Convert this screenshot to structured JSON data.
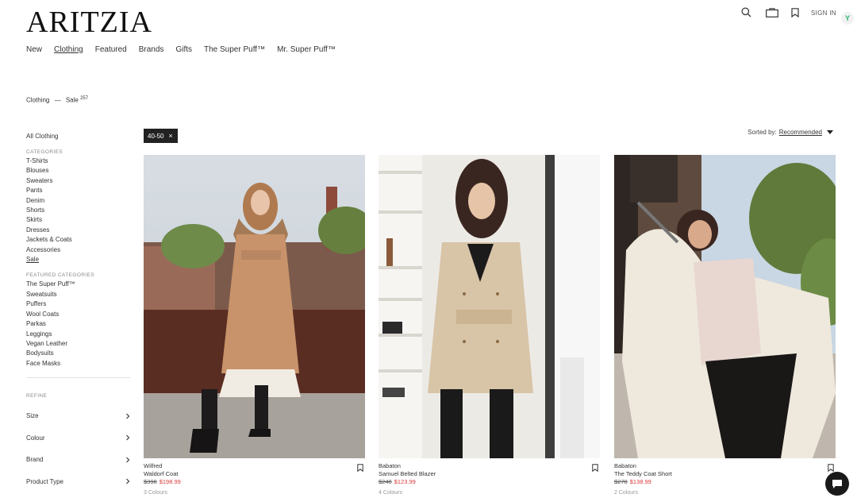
{
  "brand": {
    "logo": "ARITZIA"
  },
  "nav": {
    "items": [
      "New",
      "Clothing",
      "Featured",
      "Brands",
      "Gifts",
      "The Super Puff™",
      "Mr. Super Puff™"
    ],
    "active_index": 1
  },
  "header": {
    "signin_label": "SIGN IN",
    "extension_badge": "Y",
    "icons": [
      "search-icon",
      "bag-icon",
      "bookmark-icon"
    ]
  },
  "breadcrumb": {
    "parent": "Clothing",
    "separator": "—",
    "current": "Sale",
    "count": "257"
  },
  "sidebar": {
    "all_label": "All Clothing",
    "categories_heading": "CATEGORIES",
    "categories": [
      "T-Shirts",
      "Blouses",
      "Sweaters",
      "Pants",
      "Denim",
      "Shorts",
      "Skirts",
      "Dresses",
      "Jackets & Coats",
      "Accessories",
      "Sale"
    ],
    "categories_active": "Sale",
    "featured_heading": "FEATURED CATEGORIES",
    "featured": [
      "The Super Puff™",
      "Sweatsuits",
      "Puffers",
      "Wool Coats",
      "Parkas",
      "Leggings",
      "Vegan Leather",
      "Bodysuits",
      "Face Masks"
    ],
    "refine_heading": "REFINE",
    "refine": [
      "Size",
      "Colour",
      "Brand",
      "Product Type"
    ]
  },
  "filter_chip": {
    "label": "40-50",
    "remove": "×"
  },
  "sort": {
    "label": "Sorted by:",
    "value": "Recommended"
  },
  "products": [
    {
      "brand": "Wilfred",
      "name": "Waldorf Coat",
      "old_price": "$398",
      "sale_price": "$198.99",
      "colours": "3 Colours"
    },
    {
      "brand": "Babaton",
      "name": "Samuel Belted Blazer",
      "old_price": "$248",
      "sale_price": "$123.99",
      "colours": "4 Colours"
    },
    {
      "brand": "Babaton",
      "name": "The Teddy Coat Short",
      "old_price": "$278",
      "sale_price": "$138.99",
      "colours": "2 Colours"
    }
  ],
  "colors": {
    "sale_red": "#d93b3b",
    "text_dark": "#222222",
    "chip_bg": "#222222"
  }
}
